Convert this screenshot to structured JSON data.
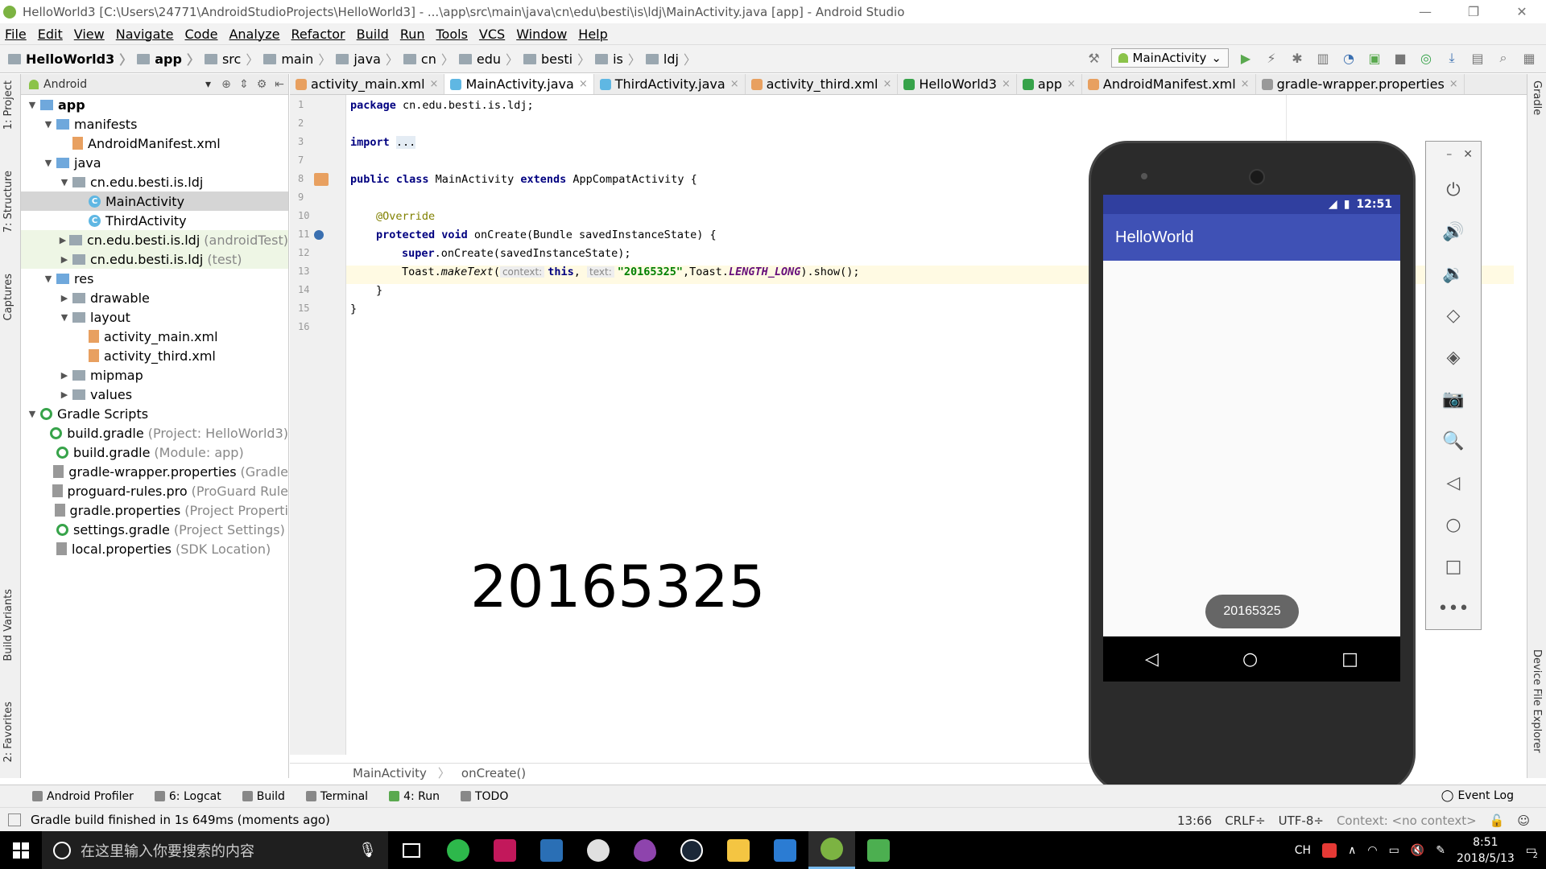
{
  "window": {
    "title": "HelloWorld3 [C:\\Users\\24771\\AndroidStudioProjects\\HelloWorld3] - ...\\app\\src\\main\\java\\cn\\edu\\besti\\is\\ldj\\MainActivity.java [app] - Android Studio",
    "minimize": "—",
    "restore": "❐",
    "close": "✕"
  },
  "menu": [
    "File",
    "Edit",
    "View",
    "Navigate",
    "Code",
    "Analyze",
    "Refactor",
    "Build",
    "Run",
    "Tools",
    "VCS",
    "Window",
    "Help"
  ],
  "breadcrumbs": [
    "HelloWorld3",
    "app",
    "src",
    "main",
    "java",
    "cn",
    "edu",
    "besti",
    "is",
    "ldj"
  ],
  "run_config": "MainActivity",
  "side_tabs_left": [
    "1: Project",
    "7: Structure",
    "Captures",
    "Build Variants",
    "2: Favorites"
  ],
  "side_tabs_right": [
    "Gradle",
    "Device File Explorer"
  ],
  "project_panel": {
    "view_mode": "Android",
    "tree": [
      {
        "indent": 0,
        "arrow": "open",
        "icon": "folder-blue",
        "label": "app",
        "hint": "",
        "bold": true
      },
      {
        "indent": 1,
        "arrow": "open",
        "icon": "folder-blue",
        "label": "manifests",
        "hint": ""
      },
      {
        "indent": 2,
        "arrow": "none",
        "icon": "xml",
        "label": "AndroidManifest.xml",
        "hint": ""
      },
      {
        "indent": 1,
        "arrow": "open",
        "icon": "folder-blue",
        "label": "java",
        "hint": ""
      },
      {
        "indent": 2,
        "arrow": "open",
        "icon": "folder",
        "label": "cn.edu.besti.is.ldj",
        "hint": ""
      },
      {
        "indent": 3,
        "arrow": "none",
        "icon": "class",
        "label": "MainActivity",
        "hint": "",
        "selected": true
      },
      {
        "indent": 3,
        "arrow": "none",
        "icon": "class",
        "label": "ThirdActivity",
        "hint": ""
      },
      {
        "indent": 2,
        "arrow": "closed",
        "icon": "folder",
        "label": "cn.edu.besti.is.ldj",
        "hint": "(androidTest)",
        "test": true
      },
      {
        "indent": 2,
        "arrow": "closed",
        "icon": "folder",
        "label": "cn.edu.besti.is.ldj",
        "hint": "(test)",
        "test": true
      },
      {
        "indent": 1,
        "arrow": "open",
        "icon": "folder-blue",
        "label": "res",
        "hint": ""
      },
      {
        "indent": 2,
        "arrow": "closed",
        "icon": "folder",
        "label": "drawable",
        "hint": ""
      },
      {
        "indent": 2,
        "arrow": "open",
        "icon": "folder",
        "label": "layout",
        "hint": ""
      },
      {
        "indent": 3,
        "arrow": "none",
        "icon": "xml",
        "label": "activity_main.xml",
        "hint": ""
      },
      {
        "indent": 3,
        "arrow": "none",
        "icon": "xml",
        "label": "activity_third.xml",
        "hint": ""
      },
      {
        "indent": 2,
        "arrow": "closed",
        "icon": "folder",
        "label": "mipmap",
        "hint": ""
      },
      {
        "indent": 2,
        "arrow": "closed",
        "icon": "folder",
        "label": "values",
        "hint": ""
      },
      {
        "indent": 0,
        "arrow": "open",
        "icon": "gradle",
        "label": "Gradle Scripts",
        "hint": ""
      },
      {
        "indent": 1,
        "arrow": "none",
        "icon": "gradle",
        "label": "build.gradle",
        "hint": "(Project: HelloWorld3)"
      },
      {
        "indent": 1,
        "arrow": "none",
        "icon": "gradle",
        "label": "build.gradle",
        "hint": "(Module: app)"
      },
      {
        "indent": 1,
        "arrow": "none",
        "icon": "props",
        "label": "gradle-wrapper.properties",
        "hint": "(Gradle"
      },
      {
        "indent": 1,
        "arrow": "none",
        "icon": "props",
        "label": "proguard-rules.pro",
        "hint": "(ProGuard Rule"
      },
      {
        "indent": 1,
        "arrow": "none",
        "icon": "props",
        "label": "gradle.properties",
        "hint": "(Project Properti"
      },
      {
        "indent": 1,
        "arrow": "none",
        "icon": "gradle",
        "label": "settings.gradle",
        "hint": "(Project Settings)"
      },
      {
        "indent": 1,
        "arrow": "none",
        "icon": "props",
        "label": "local.properties",
        "hint": "(SDK Location)"
      }
    ]
  },
  "editor_tabs": [
    {
      "label": "activity_main.xml",
      "color": "#e8a060",
      "active": false
    },
    {
      "label": "MainActivity.java",
      "color": "#5fb7e3",
      "active": true
    },
    {
      "label": "ThirdActivity.java",
      "color": "#5fb7e3",
      "active": false
    },
    {
      "label": "activity_third.xml",
      "color": "#e8a060",
      "active": false
    },
    {
      "label": "HelloWorld3",
      "color": "#37a34a",
      "active": false
    },
    {
      "label": "app",
      "color": "#37a34a",
      "active": false
    },
    {
      "label": "AndroidManifest.xml",
      "color": "#e8a060",
      "active": false
    },
    {
      "label": "gradle-wrapper.properties",
      "color": "#999999",
      "active": false
    }
  ],
  "code": {
    "line_numbers": [
      "1",
      "2",
      "3",
      "7",
      "8",
      "9",
      "10",
      "11",
      "12",
      "13",
      "14",
      "15",
      "16"
    ],
    "l1_kw": "package",
    "l1_rest": " cn.edu.besti.is.ldj;",
    "l3_kw": "import",
    "l3_dots": "...",
    "l8_kw1": "public class",
    "l8_name": " MainActivity ",
    "l8_kw2": "extends",
    "l8_rest": " AppCompatActivity {",
    "l10_ann": "@Override",
    "l11_kw": "protected void",
    "l11_rest": " onCreate(Bundle savedInstanceState) {",
    "l12_kw": "super",
    "l12_rest": ".onCreate(savedInstanceState);",
    "l13_a": "Toast.",
    "l13_method": "makeText",
    "l13_paren": "(",
    "l13_hint1": "context:",
    "l13_this": "this",
    "l13_comma": ", ",
    "l13_hint2": "text:",
    "l13_str": "\"20165325\"",
    "l13_b": ",Toast.",
    "l13_field": "LENGTH_LONG",
    "l13_end": ").show();",
    "l14": "}",
    "l15": "}"
  },
  "big_number": "20165325",
  "editor_breadcrumb": [
    "MainActivity",
    "onCreate()"
  ],
  "emulator": {
    "time": "12:51",
    "app_title": "HelloWorld",
    "toast": "20165325",
    "nav": [
      "◁",
      "○",
      "□"
    ],
    "panel_top": [
      "–",
      "✕"
    ],
    "panel_buttons": [
      "⏻",
      "🔊",
      "🔉",
      "◇",
      "◈",
      "📷",
      "🔍",
      "◁",
      "○",
      "□",
      "•••"
    ]
  },
  "tool_windows": [
    {
      "icon": "profiler-icon",
      "label": "Android Profiler"
    },
    {
      "icon": "logcat-icon",
      "label": "6: Logcat"
    },
    {
      "icon": "build-icon",
      "label": "Build"
    },
    {
      "icon": "terminal-icon",
      "label": "Terminal"
    },
    {
      "icon": "run-icon",
      "label": "4: Run"
    },
    {
      "icon": "todo-icon",
      "label": "TODO"
    }
  ],
  "event_log": "Event Log",
  "status": {
    "message": "Gradle build finished in 1s 649ms (moments ago)",
    "position": "13:66",
    "line_sep": "CRLF÷",
    "encoding": "UTF-8÷",
    "context": "Context: <no context>"
  },
  "taskbar": {
    "search_placeholder": "在这里输入你要搜索的内容",
    "ime": "CH",
    "time": "8:51",
    "date": "2018/5/13",
    "notifications": "2"
  },
  "colors": {
    "android_primary": "#3f51b5",
    "android_primary_dark": "#303f9f",
    "ide_bg": "#f2f2f2"
  }
}
